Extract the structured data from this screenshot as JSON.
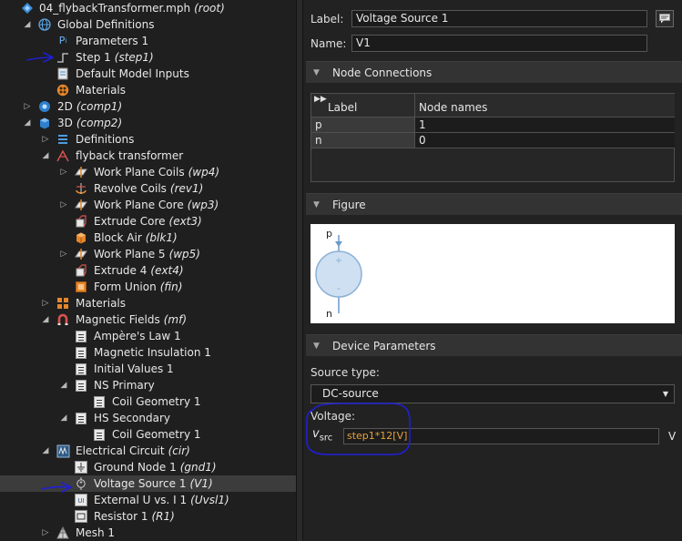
{
  "tree": {
    "rows": [
      {
        "label": "04_flybackTransformer.mph",
        "tag": "(root)",
        "icon": "model-root-icon",
        "toggle": ""
      },
      {
        "label": "Global Definitions",
        "tag": "",
        "icon": "globe-icon",
        "toggle": "expanded"
      },
      {
        "label": "Parameters 1",
        "tag": "",
        "icon": "parameters-icon",
        "toggle": ""
      },
      {
        "label": "Step 1",
        "tag": "(step1)",
        "icon": "step-function-icon",
        "toggle": ""
      },
      {
        "label": "Default Model Inputs",
        "tag": "",
        "icon": "model-inputs-icon",
        "toggle": ""
      },
      {
        "label": "Materials",
        "tag": "",
        "icon": "materials-icon",
        "toggle": ""
      },
      {
        "label": "2D",
        "tag": "(comp1)",
        "icon": "component-2d-icon",
        "toggle": "collapsed"
      },
      {
        "label": "3D",
        "tag": "(comp2)",
        "icon": "component-3d-icon",
        "toggle": "expanded"
      },
      {
        "label": "Definitions",
        "tag": "",
        "icon": "definitions-icon",
        "toggle": "collapsed"
      },
      {
        "label": "flyback transformer",
        "tag": "",
        "icon": "geometry-icon",
        "toggle": "expanded"
      },
      {
        "label": "Work Plane Coils",
        "tag": "(wp4)",
        "icon": "work-plane-icon",
        "toggle": "collapsed"
      },
      {
        "label": "Revolve Coils",
        "tag": "(rev1)",
        "icon": "revolve-icon",
        "toggle": ""
      },
      {
        "label": "Work Plane Core",
        "tag": "(wp3)",
        "icon": "work-plane-icon",
        "toggle": "collapsed"
      },
      {
        "label": "Extrude Core",
        "tag": "(ext3)",
        "icon": "extrude-icon",
        "toggle": ""
      },
      {
        "label": "Block Air",
        "tag": "(blk1)",
        "icon": "block-icon",
        "toggle": ""
      },
      {
        "label": "Work Plane 5",
        "tag": "(wp5)",
        "icon": "work-plane-icon",
        "toggle": "collapsed"
      },
      {
        "label": "Extrude 4",
        "tag": "(ext4)",
        "icon": "extrude-icon",
        "toggle": ""
      },
      {
        "label": "Form Union",
        "tag": "(fin)",
        "icon": "form-union-icon",
        "toggle": ""
      },
      {
        "label": "Materials",
        "tag": "",
        "icon": "materials-grid-icon",
        "toggle": "collapsed"
      },
      {
        "label": "Magnetic Fields",
        "tag": "(mf)",
        "icon": "magnet-icon",
        "toggle": "expanded"
      },
      {
        "label": "Ampère's Law 1",
        "tag": "",
        "icon": "physics-node-icon",
        "toggle": ""
      },
      {
        "label": "Magnetic Insulation 1",
        "tag": "",
        "icon": "physics-node-icon",
        "toggle": ""
      },
      {
        "label": "Initial Values 1",
        "tag": "",
        "icon": "physics-node-icon",
        "toggle": ""
      },
      {
        "label": "NS Primary",
        "tag": "",
        "icon": "physics-node-icon",
        "toggle": "expanded"
      },
      {
        "label": "Coil Geometry 1",
        "tag": "",
        "icon": "physics-node-icon",
        "toggle": ""
      },
      {
        "label": "HS Secondary",
        "tag": "",
        "icon": "physics-node-icon",
        "toggle": "expanded"
      },
      {
        "label": "Coil Geometry 1",
        "tag": "",
        "icon": "physics-node-icon",
        "toggle": ""
      },
      {
        "label": "Electrical Circuit",
        "tag": "(cir)",
        "icon": "circuit-icon",
        "toggle": "expanded"
      },
      {
        "label": "Ground Node 1",
        "tag": "(gnd1)",
        "icon": "ground-node-icon",
        "toggle": ""
      },
      {
        "label": "Voltage Source 1",
        "tag": "(V1)",
        "icon": "voltage-source-icon",
        "toggle": ""
      },
      {
        "label": "External U vs. I 1",
        "tag": "(Uvsl1)",
        "icon": "external-uvsi-icon",
        "toggle": ""
      },
      {
        "label": "Resistor 1",
        "tag": "(R1)",
        "icon": "resistor-icon",
        "toggle": ""
      },
      {
        "label": "Mesh 1",
        "tag": "",
        "icon": "mesh-icon",
        "toggle": "collapsed"
      }
    ],
    "selected_label": "Voltage Source 1"
  },
  "settings": {
    "label_field": {
      "label": "Label:",
      "value": "Voltage Source 1"
    },
    "name_field": {
      "label": "Name:",
      "value": "V1"
    },
    "node_connections": {
      "title": "Node Connections",
      "columns": [
        "Label",
        "Node names"
      ],
      "rows": [
        {
          "label": "p",
          "node": "1"
        },
        {
          "label": "n",
          "node": "0"
        }
      ]
    },
    "figure": {
      "title": "Figure",
      "top_terminal": "p",
      "bottom_terminal": "n",
      "plus": "+",
      "minus": "-"
    },
    "device_parameters": {
      "title": "Device Parameters",
      "source_type_label": "Source type:",
      "source_type_value": "DC-source",
      "voltage_label": "Voltage:",
      "symbol": "v",
      "symbol_sub": "src",
      "voltage_value": "step1*12[V]",
      "unit": "V"
    }
  },
  "colors": {
    "selected_row": "#3c3c3c",
    "annotation_blue": "#1f1fd6",
    "voltage_value_text": "#e6a23a"
  }
}
